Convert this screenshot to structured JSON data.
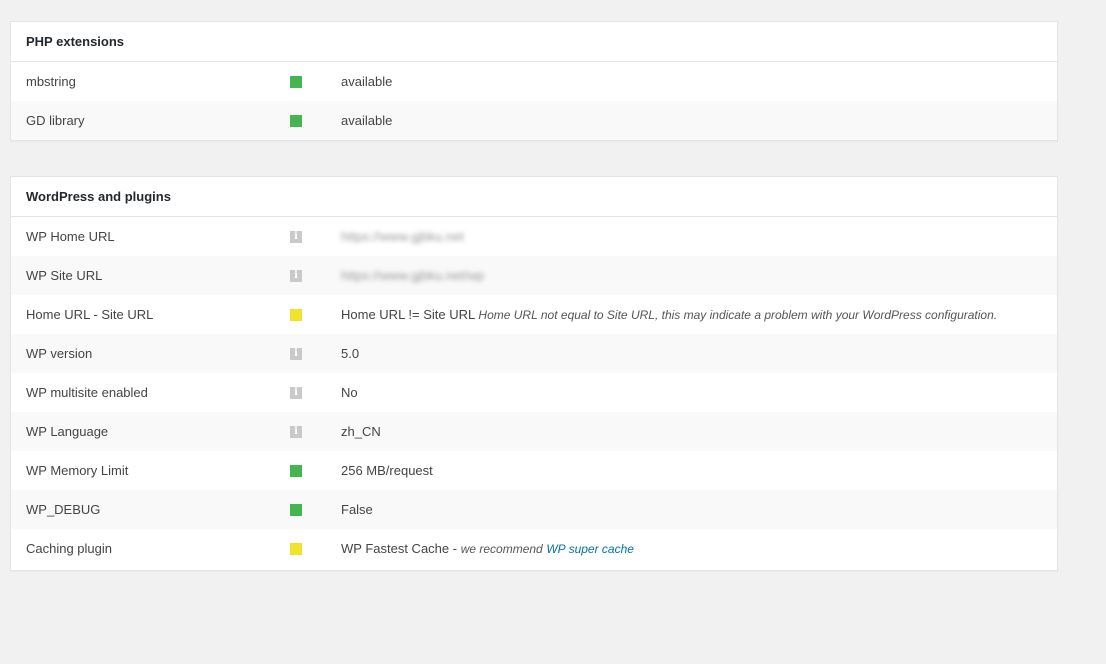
{
  "php_panel": {
    "title": "PHP extensions",
    "rows": [
      {
        "label": "mbstring",
        "status": "green",
        "value": "available"
      },
      {
        "label": "GD library",
        "status": "green",
        "value": "available"
      }
    ]
  },
  "wp_panel": {
    "title": "WordPress and plugins",
    "rows": [
      {
        "label": "WP Home URL",
        "status": "info",
        "value": "https://www.gjbku.net"
      },
      {
        "label": "WP Site URL",
        "status": "info",
        "value": "https://www.gjbku.net/wp"
      },
      {
        "label": "Home URL - Site URL",
        "status": "yellow",
        "value": "Home URL != Site URL",
        "note": "Home URL not equal to Site URL, this may indicate a problem with your WordPress configuration."
      },
      {
        "label": "WP version",
        "status": "info",
        "value": "5.0"
      },
      {
        "label": "WP multisite enabled",
        "status": "info",
        "value": "No"
      },
      {
        "label": "WP Language",
        "status": "info",
        "value": "zh_CN"
      },
      {
        "label": "WP Memory Limit",
        "status": "green",
        "value": "256 MB/request"
      },
      {
        "label": "WP_DEBUG",
        "status": "green",
        "value": "False"
      },
      {
        "label": "Caching plugin",
        "status": "yellow",
        "value": "WP Fastest Cache",
        "separator": " - ",
        "note": "we recommend",
        "link": "WP super cache"
      }
    ]
  },
  "icons": {
    "info": "info-icon",
    "ok": "status-ok-icon",
    "warning": "status-warning-icon"
  },
  "colors": {
    "ok": "#46b450",
    "warning": "#f1e22c",
    "info": "#c9c9c9",
    "link": "#0073aa"
  }
}
